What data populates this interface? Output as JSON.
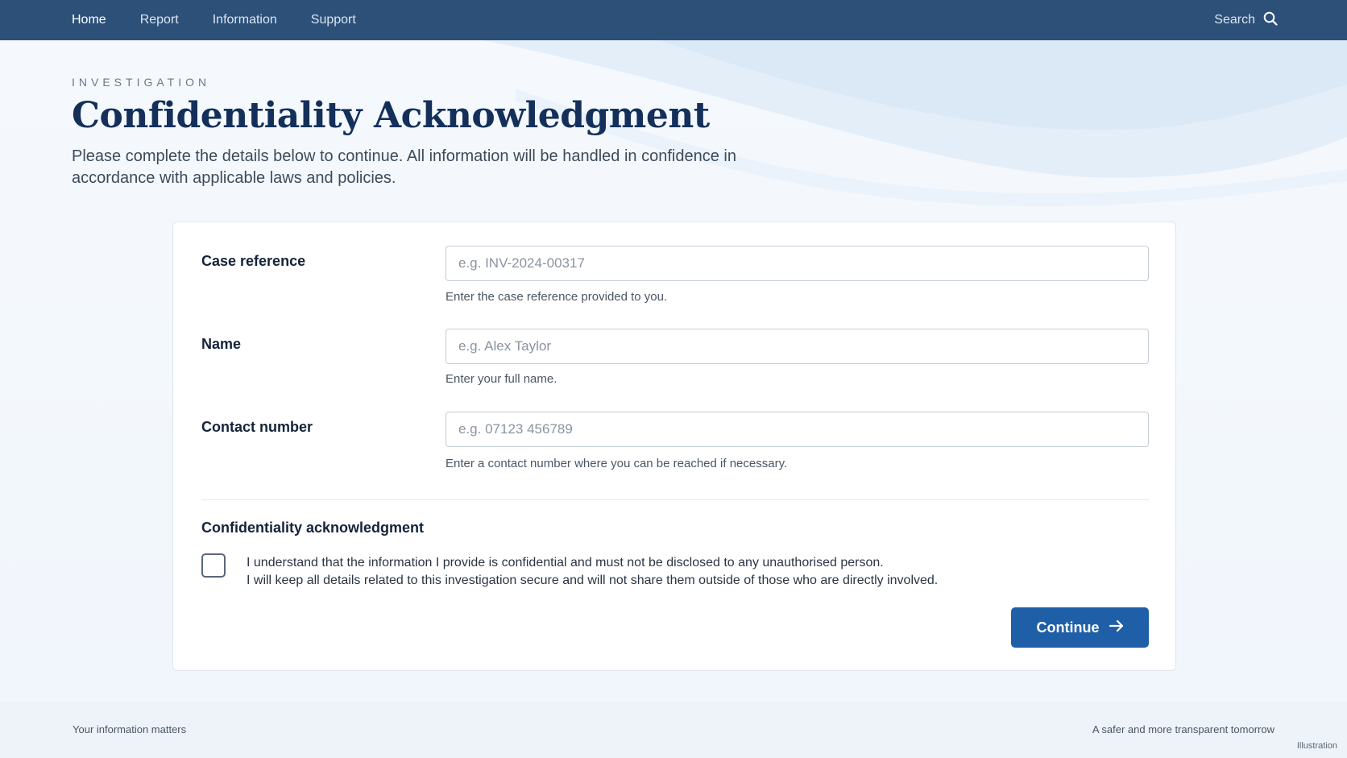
{
  "nav": {
    "items": [
      {
        "label": "Home",
        "active": true
      },
      {
        "label": "Report",
        "active": false
      },
      {
        "label": "Information",
        "active": false
      },
      {
        "label": "Support",
        "active": false
      }
    ],
    "search_label": "Search",
    "search_icon": "search-icon"
  },
  "header": {
    "eyebrow": "INVESTIGATION",
    "title": "Confidentiality Acknowledgment",
    "intro": "Please complete the details below to continue. All information will be handled in confidence in accordance with applicable laws and policies."
  },
  "form": {
    "case_reference": {
      "label": "Case reference",
      "value": "",
      "placeholder": "e.g. INV-2024-00317",
      "help": "Enter the case reference provided to you."
    },
    "name": {
      "label": "Name",
      "value": "",
      "placeholder": "e.g. Alex Taylor",
      "help": "Enter your full name."
    },
    "contact_number": {
      "label": "Contact number",
      "value": "",
      "placeholder": "e.g. 07123 456789",
      "help": "Enter a contact number where you can be reached if necessary."
    },
    "acknowledgment": {
      "heading": "Confidentiality acknowledgment",
      "checked": false,
      "line1": "I understand that the information I provide is confidential and must not be disclosed to any unauthorised person.",
      "line2": "I will keep all details related to this investigation secure and will not share them outside of those who are directly involved."
    },
    "continue_label": "Continue",
    "continue_icon": "arrow-right-icon"
  },
  "footer": {
    "left": "Your information matters",
    "right": "A safer and more transparent tomorrow",
    "badge": "Illustration"
  },
  "colors": {
    "nav_bg": "#2d5079",
    "title": "#14305a",
    "primary_button": "#1f5fa8"
  }
}
